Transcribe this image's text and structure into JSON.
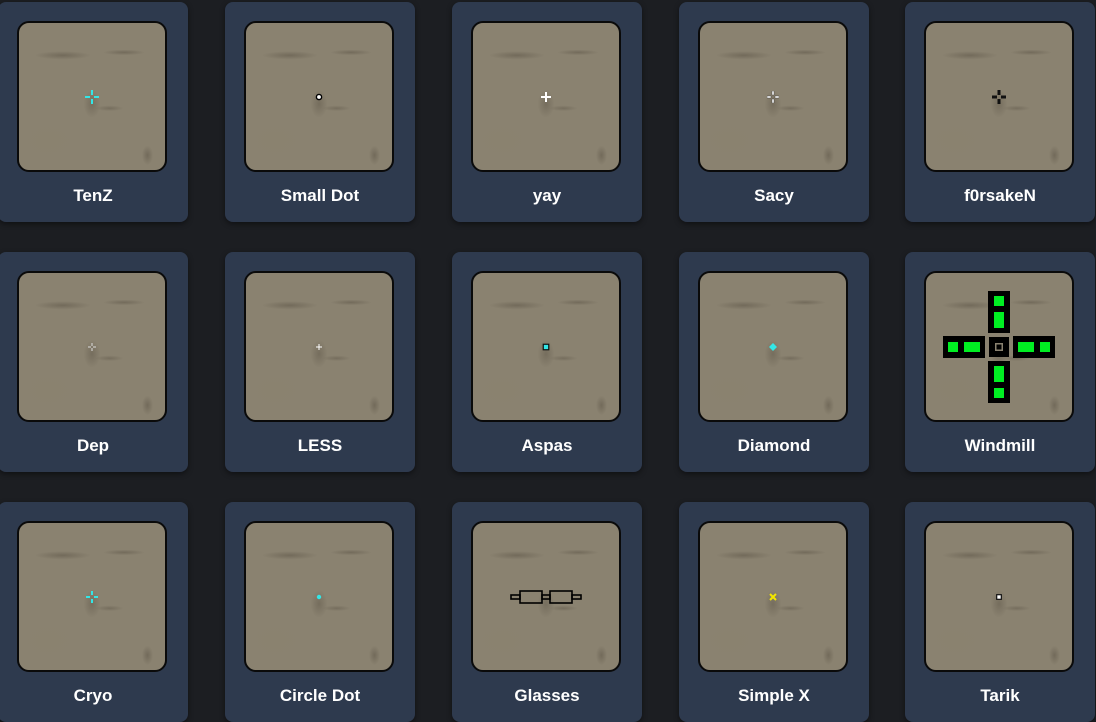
{
  "crosshairs": [
    {
      "name": "TenZ",
      "icon": "cyan-plus-crosshair-icon"
    },
    {
      "name": "Small Dot",
      "icon": "small-circle-dot-icon"
    },
    {
      "name": "yay",
      "icon": "white-plus-crosshair-icon"
    },
    {
      "name": "Sacy",
      "icon": "white-gap-plus-crosshair-icon"
    },
    {
      "name": "f0rsakeN",
      "icon": "black-plus-crosshair-icon"
    },
    {
      "name": "Dep",
      "icon": "tiny-gray-plus-crosshair-icon"
    },
    {
      "name": "LESS",
      "icon": "tiny-white-plus-crosshair-icon"
    },
    {
      "name": "Aspas",
      "icon": "cyan-square-dot-icon"
    },
    {
      "name": "Diamond",
      "icon": "cyan-diamond-dot-icon"
    },
    {
      "name": "Windmill",
      "icon": "green-windmill-crosshair-icon"
    },
    {
      "name": "Cryo",
      "icon": "cyan-gap-plus-crosshair-icon"
    },
    {
      "name": "Circle Dot",
      "icon": "cyan-dot-icon"
    },
    {
      "name": "Glasses",
      "icon": "glasses-crosshair-icon"
    },
    {
      "name": "Simple X",
      "icon": "yellow-x-crosshair-icon"
    },
    {
      "name": "Tarik",
      "icon": "white-square-dot-icon"
    }
  ],
  "colors": {
    "page_background": "#1c1e22",
    "card_background": "#2e3a4e",
    "preview_background": "#8a8270",
    "cyan": "#33e6e6",
    "green": "#00ee22",
    "yellow": "#f2e600"
  }
}
